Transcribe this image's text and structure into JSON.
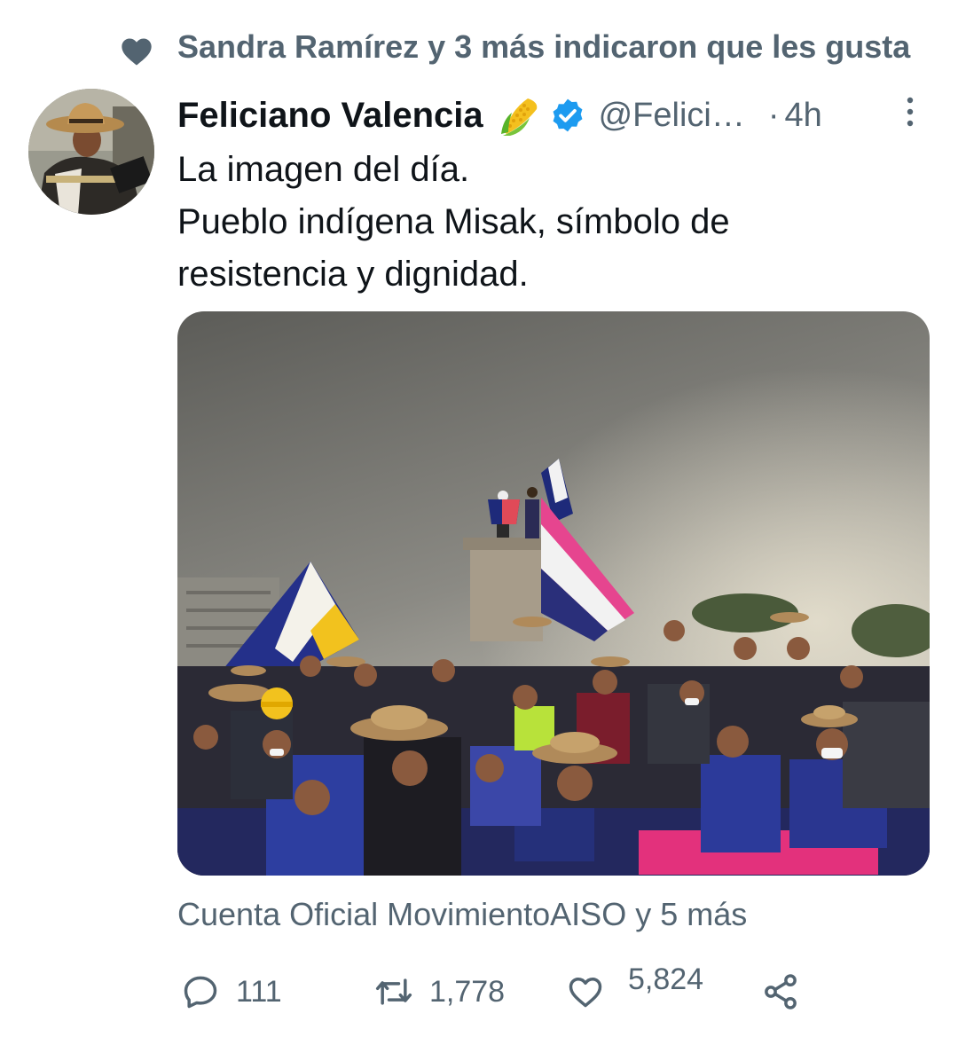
{
  "social_context": {
    "icon": "heart-icon",
    "text": "Sandra Ramírez y 3 más indicaron que les gusta"
  },
  "tweet": {
    "author_name": "Feliciano Valencia",
    "author_emoji": "corn-emoji",
    "verified": true,
    "handle": "@Felici…",
    "dot": "·",
    "time": "4h",
    "text_lines": [
      "La imagen del día.",
      "Pueblo indígena Misak, símbolo de",
      "resistencia y dignidad."
    ],
    "media_tags": "Cuenta Oficial MovimientoAISO y 5 más"
  },
  "actions": {
    "reply_count": "111",
    "retweet_count": "1,778",
    "like_count": "5,824"
  },
  "colors": {
    "primary_text": "#0f1419",
    "secondary_text": "#536471",
    "verified_blue": "#1d9bf0"
  }
}
